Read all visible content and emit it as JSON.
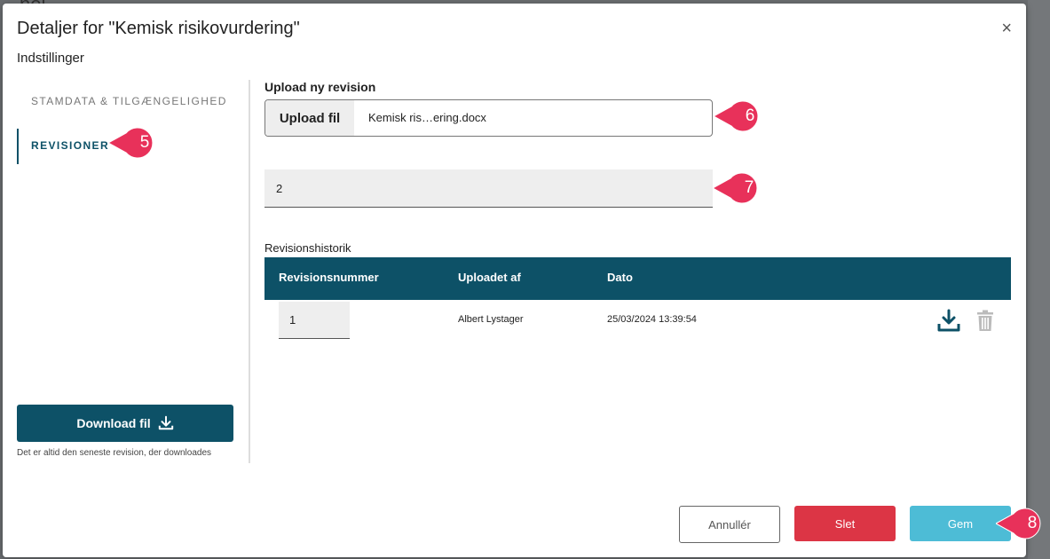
{
  "background": {
    "fragment_text": "nel"
  },
  "modal": {
    "title": "Detaljer for \"Kemisk risikovurdering\"",
    "close_symbol": "×",
    "settings_title": "Indstillinger"
  },
  "sidebar": {
    "items": [
      {
        "label": "STAMDATA & TILGÆNGELIGHED",
        "active": false
      },
      {
        "label": "REVISIONER",
        "active": true
      }
    ],
    "download_button": {
      "label": "Download fil",
      "icon": "download-icon"
    },
    "download_note": "Det er altid den seneste revision, der downloades"
  },
  "upload": {
    "label": "Upload ny revision",
    "button_label": "Upload fil",
    "file_name": "Kemisk ris…ering.docx"
  },
  "revision_field": {
    "value": "2"
  },
  "history": {
    "label": "Revisionshistorik",
    "columns": [
      "Revisionsnummer",
      "Uploadet af",
      "Dato"
    ],
    "rows": [
      {
        "revision": "1",
        "uploaded_by": "Albert Lystager",
        "date": "25/03/2024 13:39:54"
      }
    ]
  },
  "footer": {
    "cancel_label": "Annullér",
    "delete_label": "Slet",
    "save_label": "Gem"
  },
  "callouts": [
    "5",
    "6",
    "7",
    "8"
  ],
  "colors": {
    "primary": "#0d5167",
    "danger": "#dc3545",
    "save": "#4dbcd6",
    "callout": "#e8315a"
  }
}
